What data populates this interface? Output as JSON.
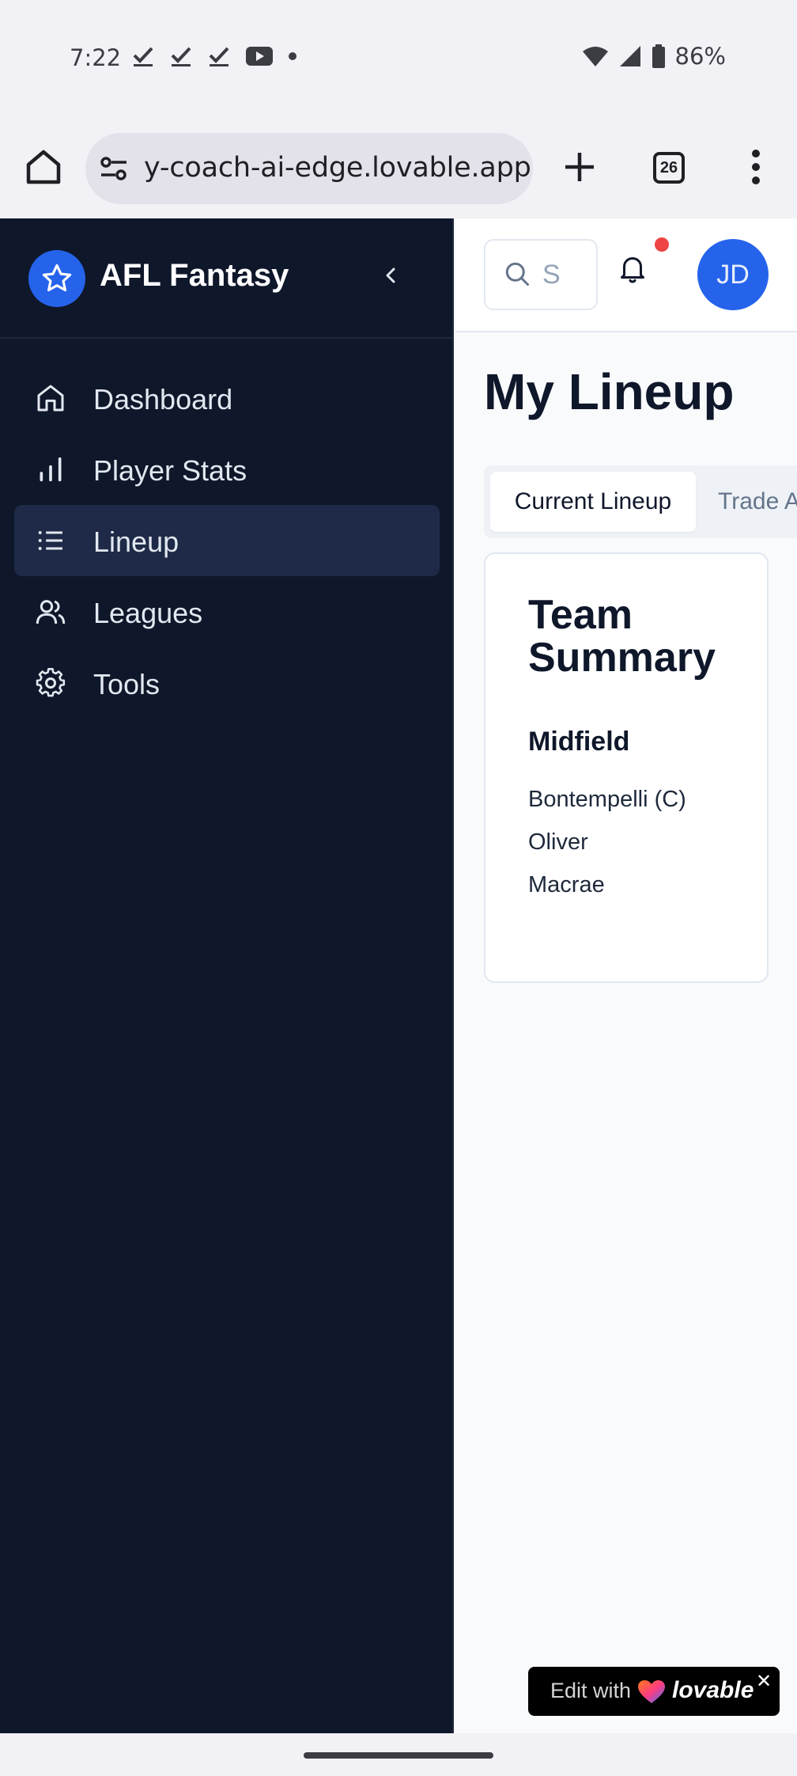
{
  "status_bar": {
    "time": "7:22",
    "battery": "86%",
    "icons": [
      "check-icon",
      "check-icon",
      "check-icon",
      "youtube-icon",
      "dot-icon",
      "wifi-icon",
      "signal-icon",
      "battery-icon"
    ]
  },
  "browser": {
    "url": "y-coach-ai-edge.lovable.app",
    "tab_count": "26"
  },
  "sidebar": {
    "brand": "AFL Fantasy",
    "items": [
      {
        "label": "Dashboard",
        "icon": "home-icon",
        "active": false
      },
      {
        "label": "Player Stats",
        "icon": "bar-chart-icon",
        "active": false
      },
      {
        "label": "Lineup",
        "icon": "list-icon",
        "active": true
      },
      {
        "label": "Leagues",
        "icon": "users-icon",
        "active": false
      },
      {
        "label": "Tools",
        "icon": "gear-icon",
        "active": false
      }
    ]
  },
  "header": {
    "search_placeholder": "S",
    "avatar_initials": "JD",
    "notification_color": "#ef4444"
  },
  "main": {
    "title": "My Lineup",
    "tabs": [
      {
        "label": "Current Lineup",
        "active": true
      },
      {
        "label": "Trade A",
        "active": false
      }
    ],
    "card": {
      "title": "Team Summary",
      "section": "Midfield",
      "players": [
        "Bontempelli (C)",
        "Oliver",
        "Macrae"
      ]
    }
  },
  "badge": {
    "edit_label": "Edit with",
    "brand": "lovable",
    "close": "✕"
  },
  "colors": {
    "sidebar_bg": "#0f172a",
    "active_item_bg": "#1e2a47",
    "accent": "#2563eb"
  }
}
